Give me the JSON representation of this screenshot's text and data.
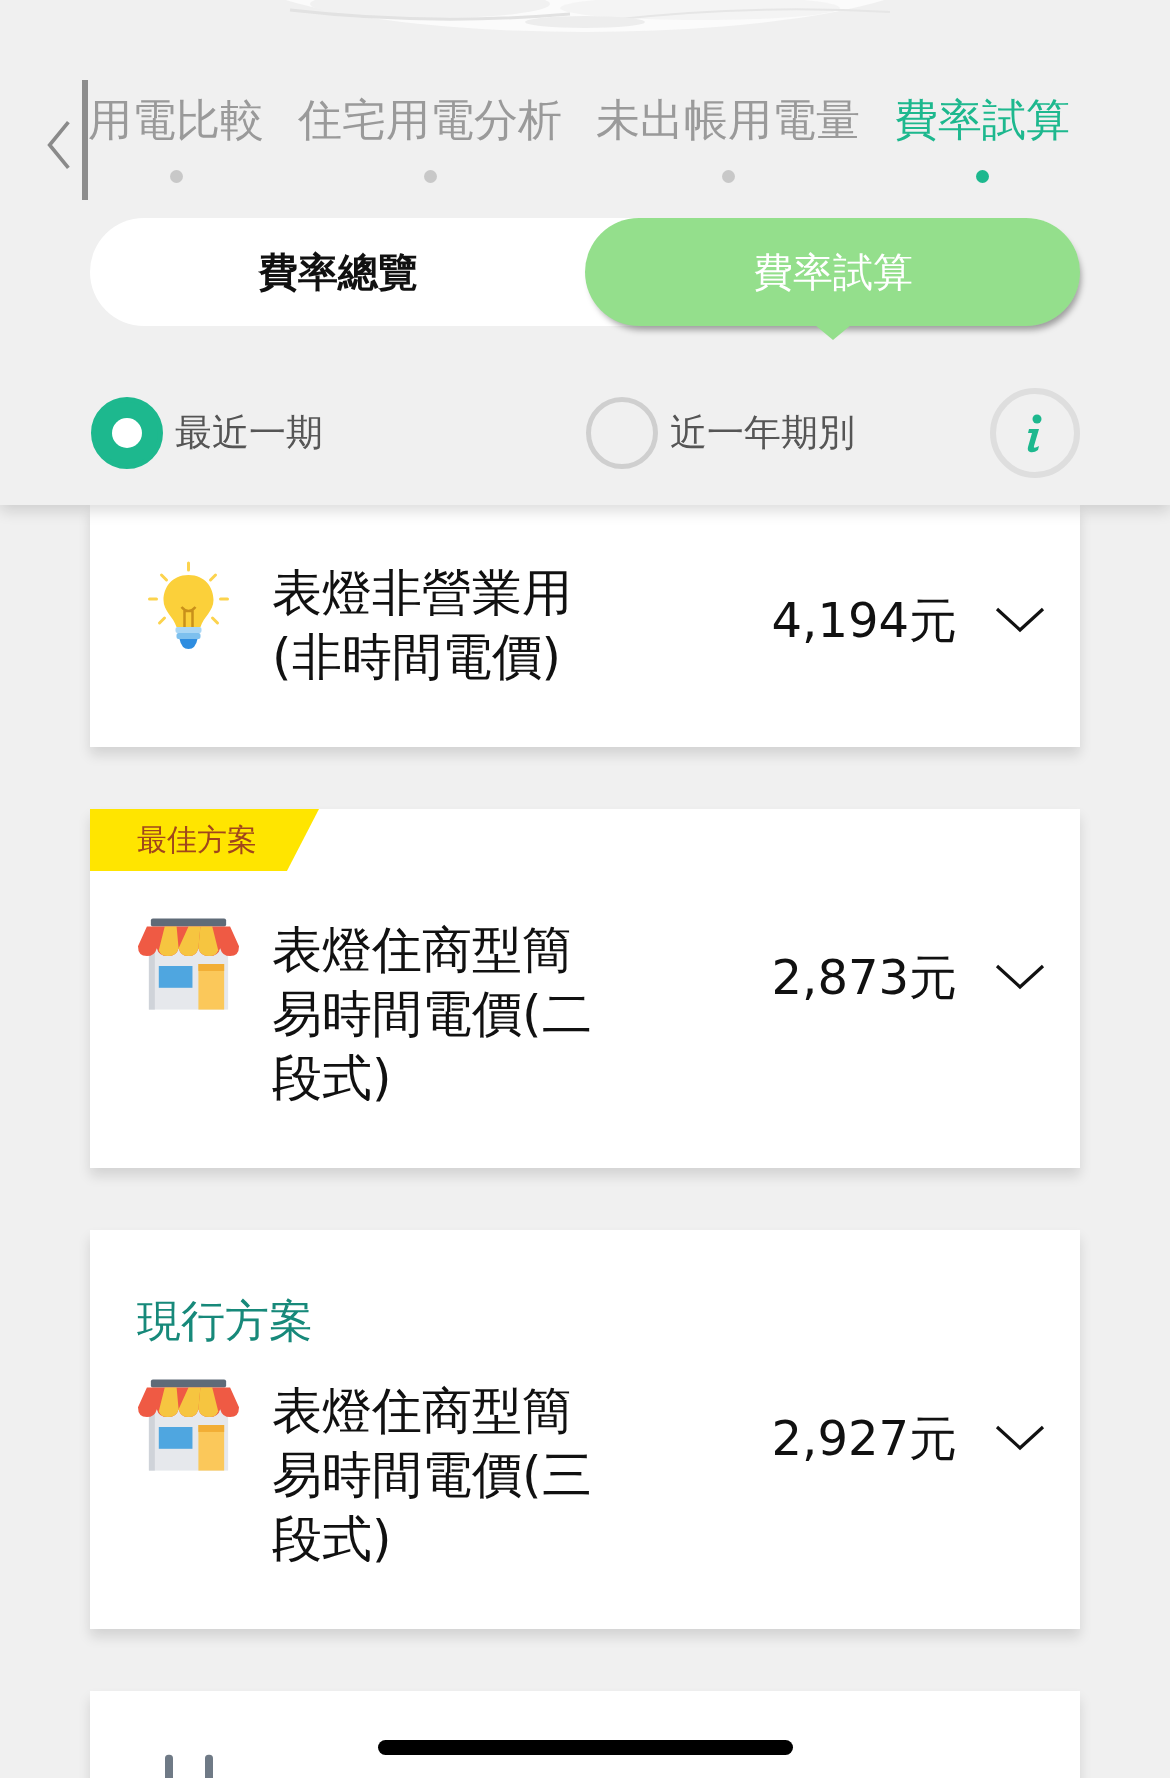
{
  "nav_tabs": [
    {
      "label": "用電比較",
      "selected": false
    },
    {
      "label": "住宅用電分析",
      "selected": false
    },
    {
      "label": "未出帳用電量",
      "selected": false
    },
    {
      "label": "費率試算",
      "selected": true
    }
  ],
  "segments": [
    {
      "label": "費率總覽",
      "selected": false
    },
    {
      "label": "費率試算",
      "selected": true
    }
  ],
  "period_options": [
    {
      "label": "最近一期",
      "selected": true
    },
    {
      "label": "近一年期別",
      "selected": false
    }
  ],
  "plans": [
    {
      "kind": "bulb",
      "name": "表燈非營業用(非時間電價)",
      "amount": "4,194元"
    },
    {
      "kind": "shop",
      "badge": "最佳方案",
      "name": "表燈住商型簡易時間電價(二段式)",
      "amount": "2,873元"
    },
    {
      "kind": "shop",
      "heading": "現行方案",
      "name": "表燈住商型簡易時間電價(三段式)",
      "amount": "2,927元"
    },
    {
      "kind": "plug"
    }
  ]
}
